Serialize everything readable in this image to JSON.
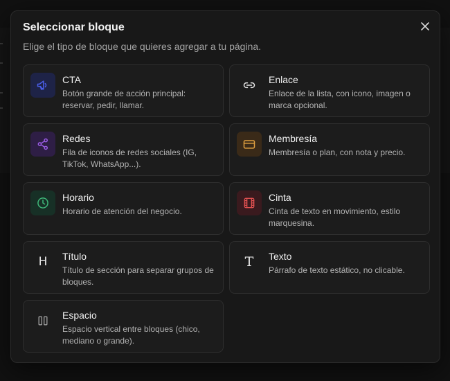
{
  "modal": {
    "title": "Seleccionar bloque",
    "subtitle": "Elige el tipo de bloque que quieres agregar a tu página.",
    "close_icon": "close-icon"
  },
  "blocks": [
    {
      "name": "CTA",
      "description": "Botón grande de acción principal: reservar, pedir, llamar.",
      "icon": "megaphone-icon",
      "icon_color": "#4a5ee8",
      "icon_bg": "#1e2347"
    },
    {
      "name": "Enlace",
      "description": "Enlace de la lista, con icono, imagen o marca opcional.",
      "icon": "link-icon",
      "icon_color": "#e6e6e6",
      "icon_bg": "#1c1c1c"
    },
    {
      "name": "Redes",
      "description": "Fila de iconos de redes sociales (IG, TikTok, WhatsApp...).",
      "icon": "share-icon",
      "icon_color": "#9b5de5",
      "icon_bg": "#2e1e45"
    },
    {
      "name": "Membresía",
      "description": "Membresía o plan, con nota y precio.",
      "icon": "card-icon",
      "icon_color": "#e0a040",
      "icon_bg": "#3a2a18"
    },
    {
      "name": "Horario",
      "description": "Horario de atención del negocio.",
      "icon": "clock-icon",
      "icon_color": "#3fb87a",
      "icon_bg": "#173026"
    },
    {
      "name": "Cinta",
      "description": "Cinta de texto en movimiento, estilo marquesina.",
      "icon": "film-icon",
      "icon_color": "#e05050",
      "icon_bg": "#3a1a1e"
    },
    {
      "name": "Título",
      "description": "Título de sección para separar grupos de bloques.",
      "icon": "heading-icon",
      "icon_color": "#e6e6e6",
      "icon_bg": "#1c1c1c",
      "glyph": "H"
    },
    {
      "name": "Texto",
      "description": "Párrafo de texto estático, no clicable.",
      "icon": "text-icon",
      "icon_color": "#e6e6e6",
      "icon_bg": "#1c1c1c",
      "glyph": "T"
    },
    {
      "name": "Espacio",
      "description": "Espacio vertical entre bloques (chico, mediano o grande).",
      "icon": "spacer-icon",
      "icon_color": "#a0a0a0",
      "icon_bg": "#1c1c1c"
    }
  ]
}
